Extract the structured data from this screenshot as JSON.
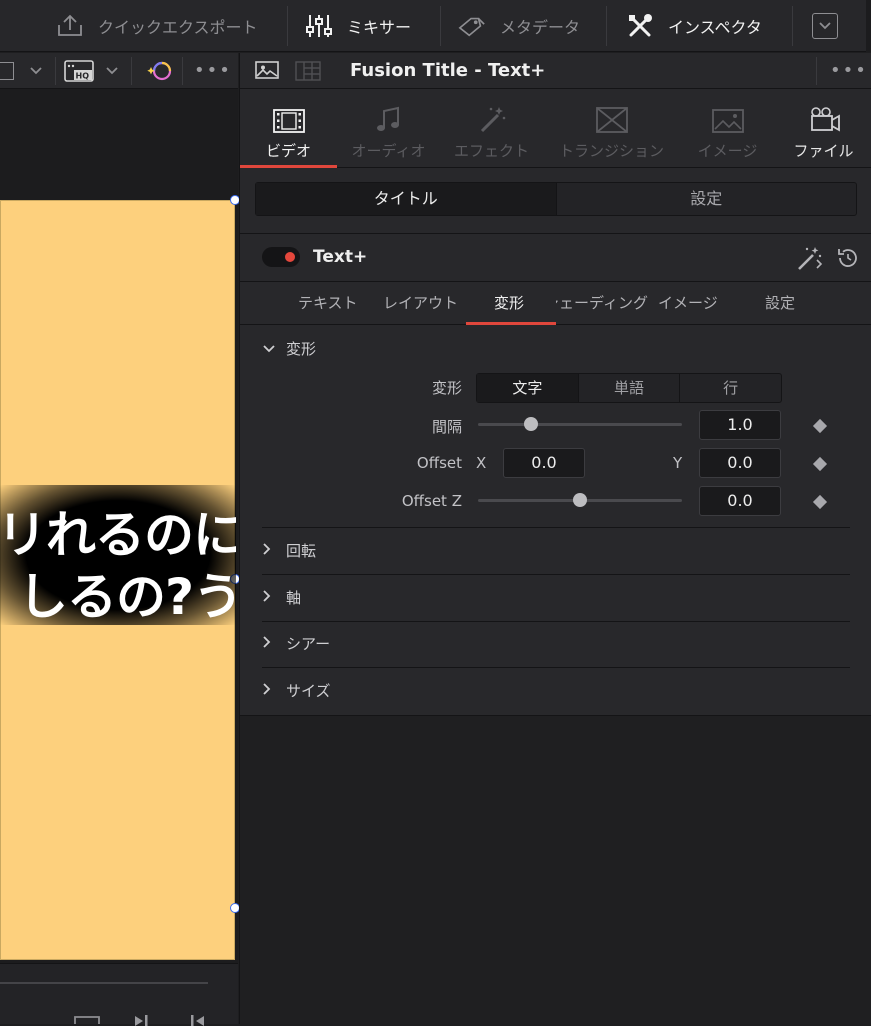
{
  "topbar": {
    "quick_export": "クイックエクスポート",
    "mixer": "ミキサー",
    "metadata": "メタデータ",
    "inspector": "インスペクタ"
  },
  "viewer": {
    "subtitle_line1": "リれるのに",
    "subtitle_line2": "しるの?う"
  },
  "inspector": {
    "title": "Fusion Title - Text+",
    "categories": [
      "ビデオ",
      "オーディオ",
      "エフェクト",
      "トランジション",
      "イメージ",
      "ファイル"
    ],
    "segment": [
      "タイトル",
      "設定"
    ],
    "node_name": "Text+",
    "sub_tabs": [
      "テキスト",
      "レイアウト",
      "変形",
      "シェーディング",
      "イメージ",
      "設定"
    ],
    "section_transform": "変形",
    "params": {
      "transform_label": "変形",
      "transform_options": [
        "文字",
        "単語",
        "行"
      ],
      "spacing_label": "間隔",
      "spacing_value": "1.0",
      "spacing_slider_level": 0.26,
      "offset_label": "Offset",
      "offset_x_label": "X",
      "offset_x_value": "0.0",
      "offset_y_label": "Y",
      "offset_y_value": "0.0",
      "offset_z_label": "Offset Z",
      "offset_z_value": "0.0",
      "offset_z_slider_level": 0.5
    },
    "collapsed_sections": [
      "回転",
      "軸",
      "シアー",
      "サイズ"
    ]
  },
  "colors": {
    "accent_red": "#e0473c",
    "canvas_bg": "#fdd07d",
    "panel_bg": "#28282b"
  }
}
